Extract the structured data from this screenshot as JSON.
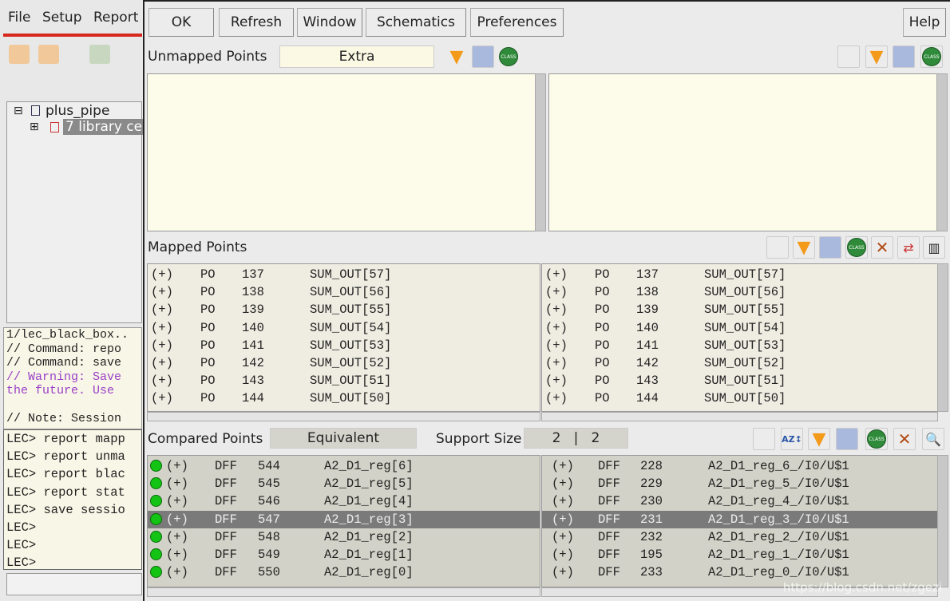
{
  "main_window": {
    "menu": [
      "File",
      "Setup",
      "Report"
    ],
    "tree": {
      "root": "plus_pipe",
      "child": "7 library ce"
    },
    "log_lines": [
      {
        "text": "1/lec_black_box..",
        "color": "#222222"
      },
      {
        "text": "// Command: repo",
        "color": "#222222"
      },
      {
        "text": "// Command: save",
        "color": "#222222"
      },
      {
        "text": "// Warning: Save",
        "color": "#9a3fc8"
      },
      {
        "text": "the future. Use",
        "color": "#9a3fc8"
      },
      {
        "text": "",
        "color": "#222222"
      },
      {
        "text": "// Note: Session",
        "color": "#222222"
      }
    ],
    "commands": [
      "LEC> report mapp",
      "LEC> report unma",
      "LEC> report blac",
      "LEC> report stat",
      "LEC> save sessio",
      "LEC>",
      "LEC>",
      "LEC>"
    ]
  },
  "dialog": {
    "buttons": {
      "ok": "OK",
      "refresh": "Refresh",
      "window": "Window",
      "schematics": "Schematics",
      "preferences": "Preferences",
      "help": "Help"
    },
    "unmapped": {
      "label": "Unmapped Points",
      "filter_value": "Extra"
    },
    "mapped": {
      "label": "Mapped Points",
      "left": [
        [
          "(+)",
          "PO",
          "137",
          "SUM_OUT[57]"
        ],
        [
          "(+)",
          "PO",
          "138",
          "SUM_OUT[56]"
        ],
        [
          "(+)",
          "PO",
          "139",
          "SUM_OUT[55]"
        ],
        [
          "(+)",
          "PO",
          "140",
          "SUM_OUT[54]"
        ],
        [
          "(+)",
          "PO",
          "141",
          "SUM_OUT[53]"
        ],
        [
          "(+)",
          "PO",
          "142",
          "SUM_OUT[52]"
        ],
        [
          "(+)",
          "PO",
          "143",
          "SUM_OUT[51]"
        ],
        [
          "(+)",
          "PO",
          "144",
          "SUM_OUT[50]"
        ]
      ],
      "right": [
        [
          "(+)",
          "PO",
          "137",
          "SUM_OUT[57]"
        ],
        [
          "(+)",
          "PO",
          "138",
          "SUM_OUT[56]"
        ],
        [
          "(+)",
          "PO",
          "139",
          "SUM_OUT[55]"
        ],
        [
          "(+)",
          "PO",
          "140",
          "SUM_OUT[54]"
        ],
        [
          "(+)",
          "PO",
          "141",
          "SUM_OUT[53]"
        ],
        [
          "(+)",
          "PO",
          "142",
          "SUM_OUT[52]"
        ],
        [
          "(+)",
          "PO",
          "143",
          "SUM_OUT[51]"
        ],
        [
          "(+)",
          "PO",
          "144",
          "SUM_OUT[50]"
        ]
      ]
    },
    "compared": {
      "label": "Compared Points",
      "filter_value": "Equivalent",
      "support_label": "Support Size",
      "support_value": "2   |   2",
      "selected_index": 3,
      "status_color": "#14c414",
      "left": [
        [
          "(+)",
          "DFF",
          "544",
          "A2_D1_reg[6]"
        ],
        [
          "(+)",
          "DFF",
          "545",
          "A2_D1_reg[5]"
        ],
        [
          "(+)",
          "DFF",
          "546",
          "A2_D1_reg[4]"
        ],
        [
          "(+)",
          "DFF",
          "547",
          "A2_D1_reg[3]"
        ],
        [
          "(+)",
          "DFF",
          "548",
          "A2_D1_reg[2]"
        ],
        [
          "(+)",
          "DFF",
          "549",
          "A2_D1_reg[1]"
        ],
        [
          "(+)",
          "DFF",
          "550",
          "A2_D1_reg[0]"
        ]
      ],
      "right": [
        [
          "(+)",
          "DFF",
          "228",
          "A2_D1_reg_6_/I0/U$1"
        ],
        [
          "(+)",
          "DFF",
          "229",
          "A2_D1_reg_5_/I0/U$1"
        ],
        [
          "(+)",
          "DFF",
          "230",
          "A2_D1_reg_4_/I0/U$1"
        ],
        [
          "(+)",
          "DFF",
          "231",
          "A2_D1_reg_3_/I0/U$1"
        ],
        [
          "(+)",
          "DFF",
          "232",
          "A2_D1_reg_2_/I0/U$1"
        ],
        [
          "(+)",
          "DFF",
          "195",
          "A2_D1_reg_1_/I0/U$1"
        ],
        [
          "(+)",
          "DFF",
          "233",
          "A2_D1_reg_0_/I0/U$1"
        ]
      ]
    },
    "icons": {
      "class_label": "CLASS"
    }
  },
  "watermark": "https://blog.csdn.net/zgezi"
}
